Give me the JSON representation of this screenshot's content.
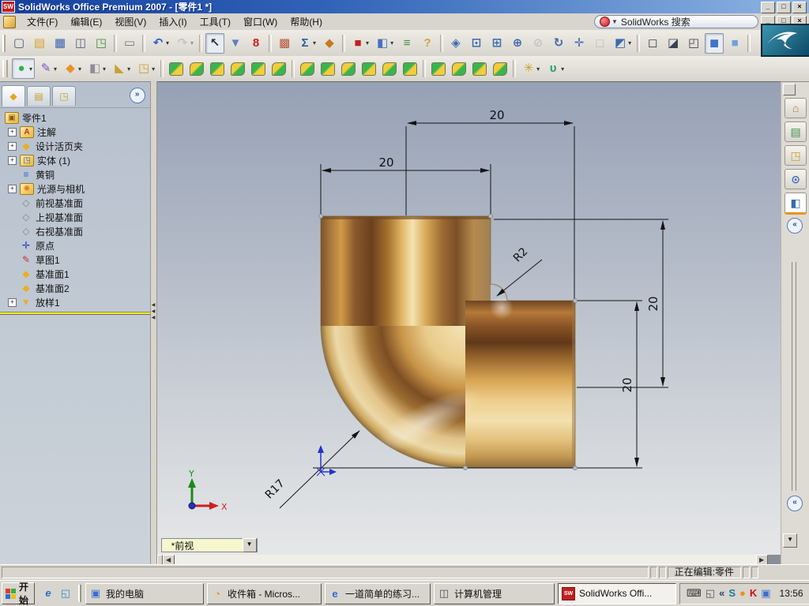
{
  "window": {
    "title": "SolidWorks Office Premium 2007 - [零件1 *]"
  },
  "menu_bar": {
    "items": [
      "文件(F)",
      "编辑(E)",
      "视图(V)",
      "插入(I)",
      "工具(T)",
      "窗口(W)",
      "帮助(H)"
    ],
    "search": {
      "text": "SolidWorks 搜索"
    }
  },
  "toolbars": {
    "standard": [
      {
        "n": "new-document",
        "g": "▢",
        "c": "#4a5a74"
      },
      {
        "n": "open-document",
        "g": "▤",
        "c": "#d8a030"
      },
      {
        "n": "save",
        "g": "▦",
        "c": "#3a62b0"
      },
      {
        "n": "make-drawing",
        "g": "◫",
        "c": "#55617a"
      },
      {
        "n": "make-assembly",
        "g": "◳",
        "c": "#3f8f46"
      },
      {
        "sep": 1
      },
      {
        "n": "print",
        "g": "▭",
        "c": "#707684"
      },
      {
        "sep": 1
      },
      {
        "n": "undo",
        "g": "↶",
        "c": "#2b5fd0",
        "dd": 1
      },
      {
        "n": "redo",
        "g": "↷",
        "c": "#9aa0aa",
        "dd": 1,
        "dis": 1
      },
      {
        "sep": 1
      },
      {
        "n": "select",
        "g": "↖",
        "c": "#2a2f3a",
        "pr": 1
      },
      {
        "n": "selection-filter",
        "g": "▼",
        "c": "#5f7fc0"
      },
      {
        "n": "stop-light",
        "g": "8",
        "c": "#cc1f1f"
      },
      {
        "sep": 1
      },
      {
        "n": "edit-color",
        "g": "▩",
        "c": "#b5553a"
      },
      {
        "n": "measure",
        "g": "Σ",
        "c": "#2a5caa",
        "dd": 1
      },
      {
        "n": "check",
        "g": "◆",
        "c": "#c87820"
      },
      {
        "sep": 1
      },
      {
        "n": "solidworks-office",
        "g": "■",
        "c": "#c02020",
        "dd": 1
      },
      {
        "n": "window-layout",
        "g": "◧",
        "c": "#4a6fc0",
        "dd": 1
      },
      {
        "n": "options",
        "g": "≡",
        "c": "#3f8f46"
      },
      {
        "n": "help",
        "g": "?",
        "c": "#d8a030"
      },
      {
        "sep": 1
      },
      {
        "n": "view-orientation",
        "g": "◈",
        "c": "#3a6ab0"
      },
      {
        "n": "zoom-to-fit",
        "g": "⊡",
        "c": "#3a6ab0"
      },
      {
        "n": "zoom-to-area",
        "g": "⊞",
        "c": "#3a6ab0"
      },
      {
        "n": "zoom-in-out",
        "g": "⊕",
        "c": "#3a6ab0"
      },
      {
        "n": "zoom-to-selection",
        "g": "⊘",
        "c": "#9aa0aa",
        "dis": 1
      },
      {
        "n": "rotate-view",
        "g": "↻",
        "c": "#3a6ab0"
      },
      {
        "n": "pan",
        "g": "✛",
        "c": "#3a6ab0"
      },
      {
        "n": "3d-drawing-view",
        "g": "◻",
        "c": "#9aa0aa",
        "dis": 1
      },
      {
        "n": "standard-views",
        "g": "◩",
        "c": "#3a6ab0",
        "dd": 1
      },
      {
        "sep": 1
      },
      {
        "n": "wireframe",
        "g": "◻",
        "c": "#3a4250"
      },
      {
        "n": "hidden-lines-visible",
        "g": "◪",
        "c": "#3a4250"
      },
      {
        "n": "hidden-lines-removed",
        "g": "◰",
        "c": "#3a4250"
      },
      {
        "n": "shaded-with-edges",
        "g": "◼",
        "c": "#3f74cc",
        "pr": 1
      },
      {
        "n": "shaded",
        "g": "■",
        "c": "#6fa0e0"
      },
      {
        "sep": 1
      },
      {
        "n": "shadows-in-shaded-mode",
        "g": "◒",
        "c": "#30425c"
      },
      {
        "n": "section-view",
        "g": "◫",
        "c": "#3f74cc"
      },
      {
        "n": "realview-graphics",
        "g": "●",
        "c": "#d8a030",
        "pr": 1
      }
    ],
    "command_groups": [
      {
        "n": "features-group",
        "g": "●",
        "c": "#2eb24a",
        "dd": 1,
        "pr": 1
      },
      {
        "n": "sketch-group",
        "g": "✎",
        "c": "#7a4fd0",
        "dd": 1
      },
      {
        "n": "surfaces-group",
        "g": "◆",
        "c": "#e8922a",
        "dd": 1
      },
      {
        "n": "sheet-metal-group",
        "g": "◧",
        "c": "#8a8f98",
        "dd": 1
      },
      {
        "n": "weldments-group",
        "g": "◣",
        "c": "#c8a030",
        "dd": 1
      },
      {
        "n": "mold-tools-group",
        "g": "◳",
        "c": "#caa02a",
        "dd": 1
      },
      {
        "sep": 1
      }
    ],
    "features": [
      {
        "n": "extruded-boss",
        "chip": 1
      },
      {
        "n": "extruded-cut",
        "chip": 1
      },
      {
        "n": "revolved-boss",
        "chip": 1
      },
      {
        "n": "swept-boss",
        "chip": 1
      },
      {
        "n": "cut-sweep",
        "chip": 1
      },
      {
        "n": "lofted-boss",
        "chip": 1
      },
      {
        "sep": 1
      },
      {
        "n": "fillet",
        "chip": 1
      },
      {
        "n": "chamfer",
        "chip": 1
      },
      {
        "n": "rib",
        "chip": 1
      },
      {
        "n": "shell",
        "chip": 1
      },
      {
        "n": "draft",
        "chip": 1
      },
      {
        "n": "hole-wizard",
        "chip": 1
      },
      {
        "sep": 1
      },
      {
        "n": "linear-pattern",
        "chip": 1
      },
      {
        "n": "circular-pattern",
        "chip": 1
      },
      {
        "n": "mirror",
        "chip": 1
      },
      {
        "n": "move-copy",
        "chip": 1
      },
      {
        "sep": 1
      },
      {
        "n": "reference-geometry",
        "g": "✳",
        "c": "#caa02a",
        "dd": 1
      },
      {
        "n": "curves",
        "g": "υ",
        "c": "#2aa06a",
        "dd": 1
      }
    ]
  },
  "feature_tree": {
    "tabs": [
      {
        "n": "featuremanager-tab",
        "g": "◆",
        "c": "#e0a820",
        "active": 1
      },
      {
        "n": "propertymanager-tab",
        "g": "▤",
        "c": "#c89a2a"
      },
      {
        "n": "configurationmanager-tab",
        "g": "◳",
        "c": "#c89a2a"
      }
    ],
    "expand_button": "»",
    "root": "零件1",
    "items": [
      {
        "label": "注解",
        "icon": "annotations",
        "exp": 1,
        "g": "A",
        "c": "#c03030",
        "boxed": 1
      },
      {
        "label": "设计活页夹",
        "icon": "design-binder",
        "exp": 1,
        "g": "◆",
        "c": "#e8b020"
      },
      {
        "label": "实体 (1)",
        "icon": "solid-bodies-folder",
        "exp": 1,
        "g": "◳",
        "c": "#3a5fd0",
        "boxed": 1
      },
      {
        "label": "黄铜",
        "icon": "material",
        "g": "≡",
        "c": "#3a66cc"
      },
      {
        "label": "光源与相机",
        "icon": "lights-and-cameras",
        "exp": 1,
        "g": "✺",
        "c": "#e07820",
        "boxed": 1
      },
      {
        "label": "前视基准面",
        "icon": "front-plane",
        "g": "◇",
        "c": "#7d8794"
      },
      {
        "label": "上视基准面",
        "icon": "top-plane",
        "g": "◇",
        "c": "#7d8794"
      },
      {
        "label": "右视基准面",
        "icon": "right-plane",
        "g": "◇",
        "c": "#7d8794"
      },
      {
        "label": "原点",
        "icon": "origin",
        "g": "✛",
        "c": "#2233cc"
      },
      {
        "label": "草图1",
        "icon": "sketch",
        "g": "✎",
        "c": "#cc3333"
      },
      {
        "label": "基准面1",
        "icon": "plane-1",
        "g": "◆",
        "c": "#e8b020"
      },
      {
        "label": "基准面2",
        "icon": "plane-2",
        "g": "◆",
        "c": "#e8b020"
      },
      {
        "label": "放样1",
        "icon": "loft",
        "exp": 1,
        "g": "▼",
        "c": "#e8b020"
      }
    ]
  },
  "viewport": {
    "view_selector": "*前视",
    "dims": {
      "top_width": "20",
      "upper_width": "20",
      "right_height": "20",
      "inner_height": "20",
      "fillet_radius": "R2",
      "bend_radius": "R17"
    },
    "triad": {
      "x": "X",
      "y": "Y"
    }
  },
  "task_pane": {
    "tabs": [
      {
        "n": "home",
        "g": "⌂",
        "c": "#b07820"
      },
      {
        "n": "design-library",
        "g": "▤",
        "c": "#3f8f46"
      },
      {
        "n": "file-explorer",
        "g": "◳",
        "c": "#caa02a"
      },
      {
        "n": "search",
        "g": "⊙",
        "c": "#3a6ab0"
      },
      {
        "n": "view-palette",
        "g": "◧",
        "c": "#3a6ab0",
        "active": 1
      }
    ],
    "collapse": "«"
  },
  "status_bar": {
    "editing": "正在编辑:零件"
  },
  "taskbar": {
    "start": "开始",
    "quick_launch": [
      {
        "n": "internet-explorer",
        "g": "e",
        "c": "#2a6fd0"
      },
      {
        "n": "show-desktop",
        "g": "◱",
        "c": "#2a8fd0"
      }
    ],
    "buttons": [
      {
        "label": "我的电脑",
        "icon": "my-computer",
        "g": "▣",
        "c": "#3a6fd0"
      },
      {
        "label": "收件箱 - Micros...",
        "icon": "inbox",
        "g": "◔",
        "c": "#e8941a"
      },
      {
        "label": "一道简单的练习...",
        "icon": "ie-document",
        "g": "e",
        "c": "#2a6fd0"
      },
      {
        "label": "计算机管理",
        "icon": "computer-management",
        "g": "◫",
        "c": "#44506a"
      },
      {
        "label": "SolidWorks Offi...",
        "icon": "solidworks",
        "sw": 1,
        "active": 1
      }
    ],
    "tray": {
      "icons": [
        {
          "n": "keyboard",
          "g": "⌨",
          "c": "#333333"
        },
        {
          "n": "panel-restore",
          "g": "◱",
          "c": "#555555"
        },
        {
          "n": "tray-collapse",
          "g": "«",
          "c": "#334466"
        },
        {
          "n": "solidworks-swallow",
          "g": "S",
          "c": "#1a7a9a"
        },
        {
          "n": "clock",
          "g": "●",
          "c": "#e8941a"
        },
        {
          "n": "kaspersky",
          "g": "K",
          "c": "#cc1010"
        },
        {
          "n": "network",
          "g": "▣",
          "c": "#3a6fd0"
        }
      ],
      "time": "13:56"
    }
  }
}
